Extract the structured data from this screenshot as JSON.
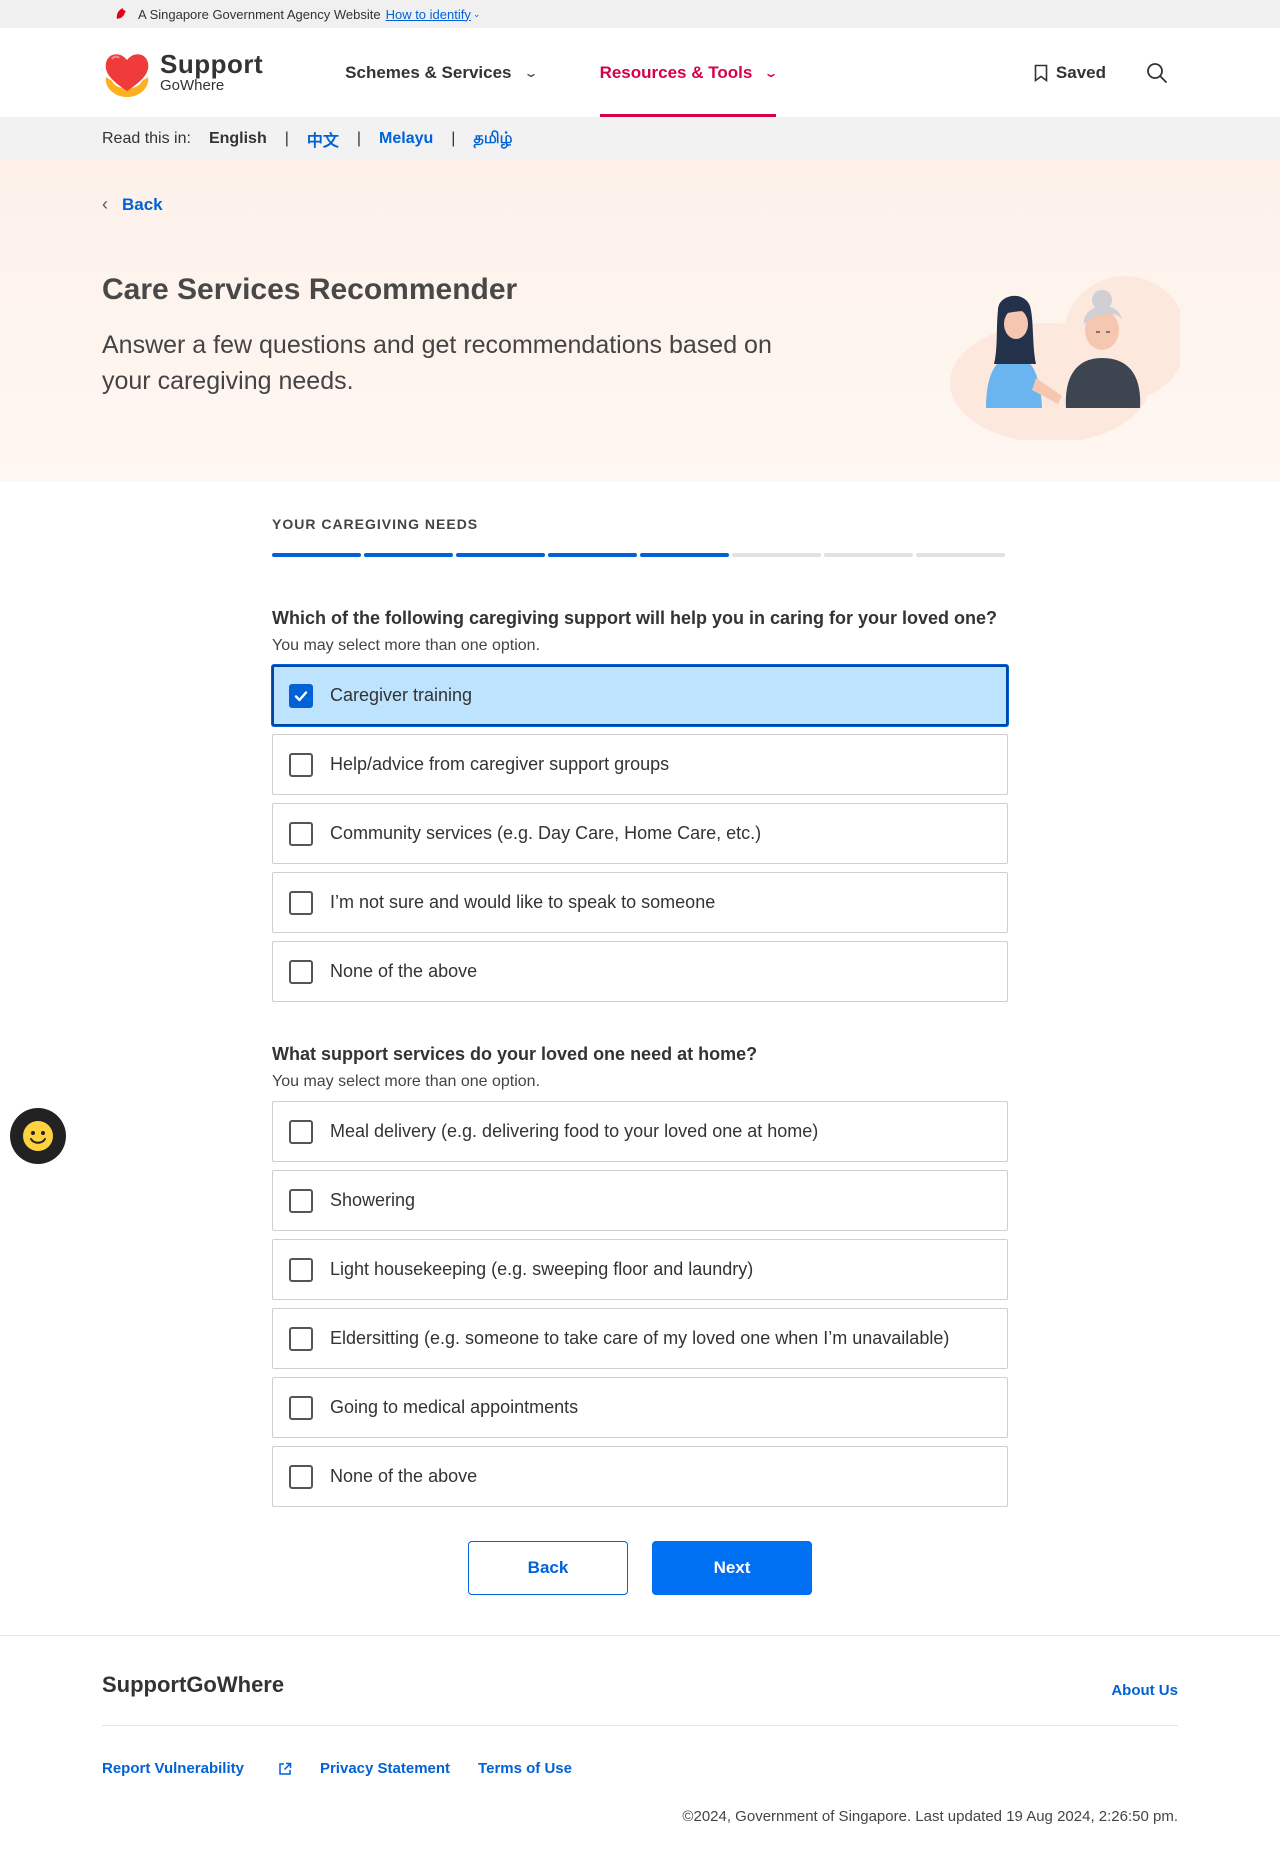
{
  "masthead": {
    "text": "A Singapore Government Agency Website",
    "link": "How to identify"
  },
  "header": {
    "logo_title": "Support",
    "logo_subtitle": "GoWhere",
    "nav": [
      {
        "label": "Schemes & Services",
        "active": false
      },
      {
        "label": "Resources & Tools",
        "active": true
      }
    ],
    "saved_label": "Saved"
  },
  "language_bar": {
    "prefix": "Read this in:",
    "languages": [
      "English",
      "中文",
      "Melayu",
      "தமிழ்"
    ],
    "current": "English"
  },
  "hero": {
    "back_label": "Back",
    "title": "Care Services Recommender",
    "subtitle": "Answer a few questions and get recommendations based on your caregiving needs."
  },
  "form": {
    "section_title": "YOUR CAREGIVING NEEDS",
    "progress": {
      "completed_steps": 5,
      "total_steps": 8
    },
    "questions": [
      {
        "label": "Which of the following caregiving support will help you in caring for your loved one?",
        "hint": "You may select more than one option.",
        "options": [
          {
            "label": "Caregiver training",
            "checked": true
          },
          {
            "label": "Help/advice from caregiver support groups",
            "checked": false
          },
          {
            "label": "Community services (e.g. Day Care, Home Care, etc.)",
            "checked": false
          },
          {
            "label": "I’m not sure and would like to speak to someone",
            "checked": false
          },
          {
            "label": "None of the above",
            "checked": false
          }
        ]
      },
      {
        "label": "What support services do your loved one need at home?",
        "hint": "You may select more than one option.",
        "options": [
          {
            "label": "Meal delivery (e.g. delivering food to your loved one at home)",
            "checked": false
          },
          {
            "label": "Showering",
            "checked": false
          },
          {
            "label": "Light housekeeping (e.g. sweeping floor and laundry)",
            "checked": false
          },
          {
            "label": "Eldersitting (e.g. someone to take care of my loved one when I’m unavailable)",
            "checked": false
          },
          {
            "label": "Going to medical appointments",
            "checked": false
          },
          {
            "label": "None of the above",
            "checked": false
          }
        ]
      }
    ],
    "back_button": "Back",
    "next_button": "Next"
  },
  "footer": {
    "brand": "SupportGoWhere",
    "about": "About Us",
    "links": [
      "Report Vulnerability",
      "Privacy Statement",
      "Terms of Use"
    ],
    "copyright": "©2024, Government of Singapore. Last updated 19 Aug 2024, 2:26:50 pm."
  },
  "colors": {
    "accent_blue": "#0062d6",
    "nav_active": "#d6004c",
    "selected_option_bg": "#bde3ff",
    "hero_bg": "#fdf1ea"
  },
  "icons": {
    "masthead": "lion-head-icon",
    "header": [
      "chevron-down-icon",
      "bookmark-icon",
      "search-icon"
    ],
    "back": "chevron-left-icon",
    "feedback": "smiley-face-icon",
    "checkbox": "checkmark-icon",
    "external_link": "external-link-icon"
  }
}
